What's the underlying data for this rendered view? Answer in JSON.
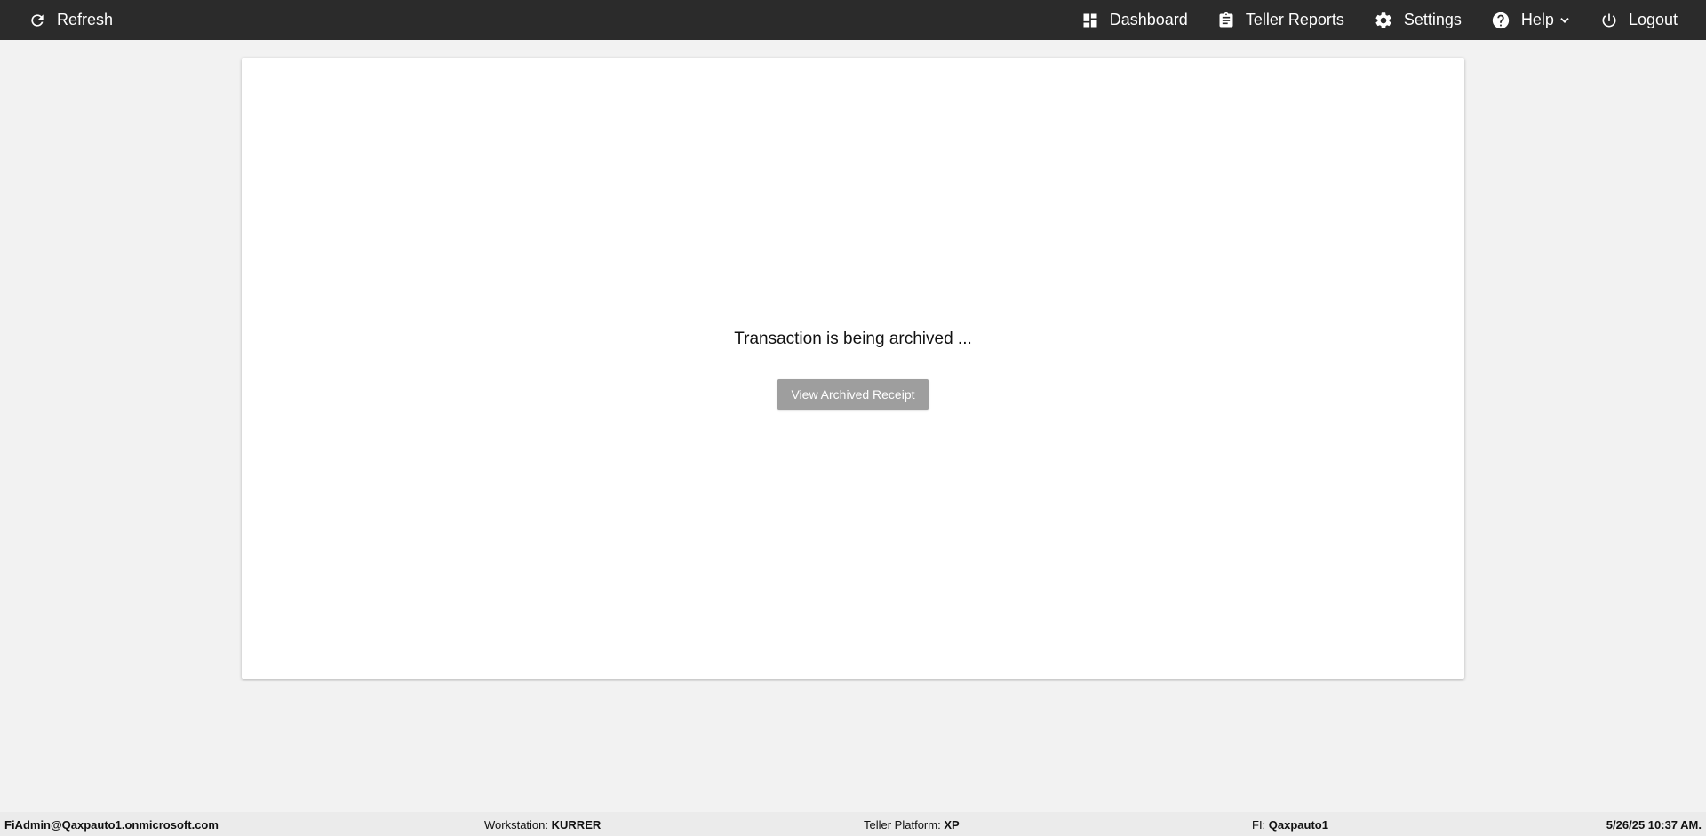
{
  "topbar": {
    "refresh_label": "Refresh",
    "nav": {
      "dashboard": "Dashboard",
      "teller_reports": "Teller Reports",
      "settings": "Settings",
      "help": "Help",
      "logout": "Logout"
    }
  },
  "main": {
    "status_message": "Transaction is being archived ...",
    "view_button": "View Archived Receipt"
  },
  "footer": {
    "user": "FiAdmin@Qaxpauto1.onmicrosoft.com",
    "workstation_label": "Workstation:",
    "workstation_value": "KURRER",
    "platform_label": "Teller Platform:",
    "platform_value": "XP",
    "fi_label": "FI:",
    "fi_value": "Qaxpauto1",
    "datetime": "5/26/25 10:37 AM."
  },
  "colors": {
    "topbar_bg": "#2b2b2b",
    "page_bg": "#f2f2f2",
    "button_bg": "#9e9e9e",
    "footer_bg": "#ebebeb"
  },
  "icons": {
    "refresh": "refresh-icon",
    "dashboard": "dashboard-icon",
    "teller_reports": "clipboard-icon",
    "settings": "gear-icon",
    "help": "help-circle-icon",
    "help_menu": "chevron-down-icon",
    "logout": "power-icon"
  }
}
